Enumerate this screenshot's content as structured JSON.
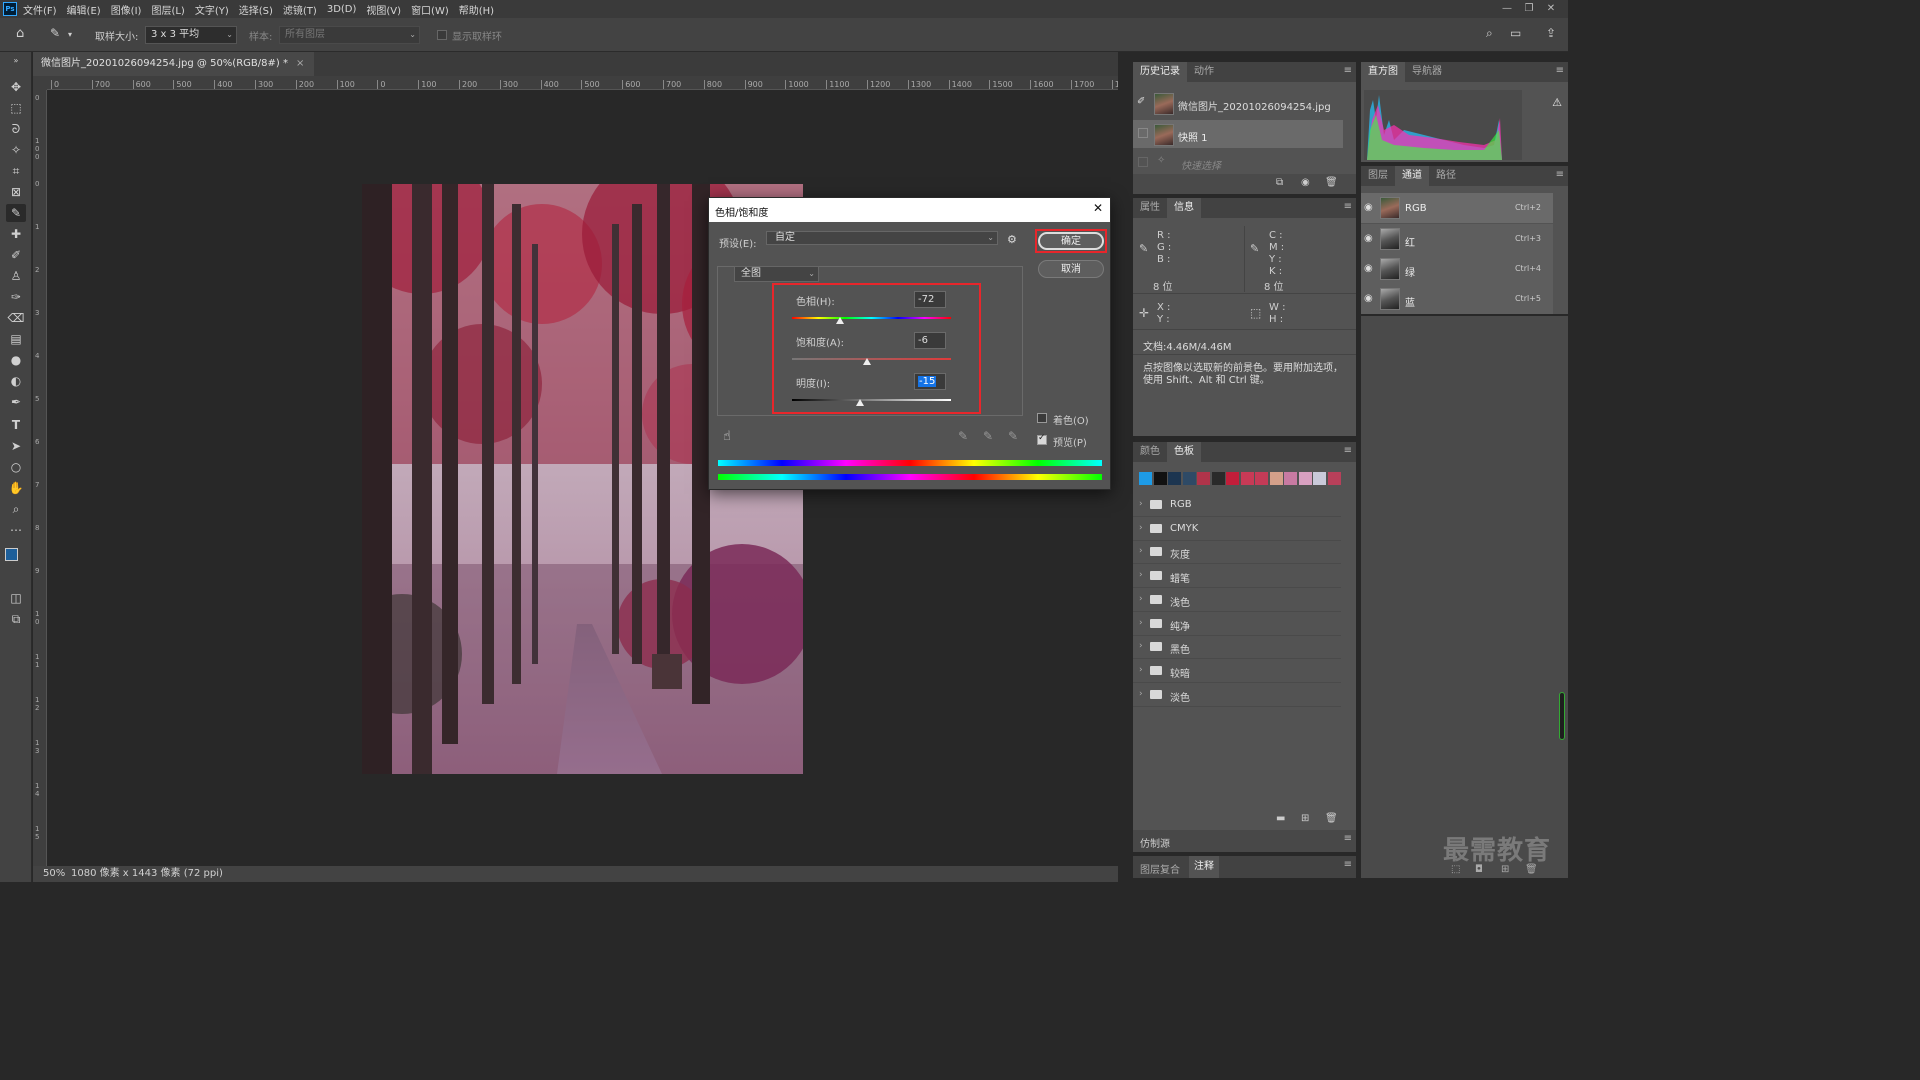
{
  "app": {
    "logo": "Ps"
  },
  "menu": [
    "文件(F)",
    "编辑(E)",
    "图像(I)",
    "图层(L)",
    "文字(Y)",
    "选择(S)",
    "滤镜(T)",
    "3D(D)",
    "视图(V)",
    "窗口(W)",
    "帮助(H)"
  ],
  "window_controls": {
    "minimize": "—",
    "restore": "❐",
    "close": "✕"
  },
  "options_bar": {
    "sample_size_label": "取样大小:",
    "sample_size_value": "3 x 3 平均",
    "sample_label": "样本:",
    "sample_value": "所有图层",
    "show_ring_label": "显示取样环"
  },
  "document": {
    "tab_title": "微信图片_20201026094254.jpg @ 50%(RGB/8#) *",
    "zoom": "50%",
    "status": "1080 像素 x 1443 像素 (72 ppi)"
  },
  "ruler_h": [
    "0",
    "700",
    "600",
    "500",
    "400",
    "300",
    "200",
    "100",
    "0",
    "100",
    "200",
    "300",
    "400",
    "500",
    "600",
    "700",
    "800",
    "900",
    "1000",
    "1100",
    "1200",
    "1300",
    "1400",
    "1500",
    "1600",
    "1700",
    "180"
  ],
  "ruler_v": [
    "0",
    "100",
    "0",
    "1",
    "2",
    "3",
    "4",
    "5",
    "6",
    "7",
    "8",
    "9",
    "10",
    "11",
    "12",
    "13",
    "14",
    "15"
  ],
  "history_panel": {
    "tabs": [
      "历史记录",
      "动作"
    ],
    "items": [
      "微信图片_20201026094254.jpg",
      "快照 1",
      "快速选择"
    ]
  },
  "histogram_panel": {
    "tabs": [
      "直方图",
      "导航器"
    ],
    "warning_icon": "⚠"
  },
  "info_panel": {
    "tabs": [
      "属性",
      "信息"
    ],
    "rgb": [
      "R :",
      "G :",
      "B :"
    ],
    "cmyk": [
      "C :",
      "M :",
      "Y :",
      "K :"
    ],
    "bits_left": "8 位",
    "bits_right": "8 位",
    "xy": [
      "X :",
      "Y :"
    ],
    "wh": [
      "W :",
      "H :"
    ],
    "doc_size": "文档:4.46M/4.46M",
    "hint": "点按图像以选取新的前景色。要用附加选项，使用 Shift、Alt 和 Ctrl 键。"
  },
  "channels_panel": {
    "tabs": [
      "图层",
      "通道",
      "路径"
    ],
    "channels": [
      {
        "name": "RGB",
        "shortcut": "Ctrl+2"
      },
      {
        "name": "红",
        "shortcut": "Ctrl+3"
      },
      {
        "name": "绿",
        "shortcut": "Ctrl+4"
      },
      {
        "name": "蓝",
        "shortcut": "Ctrl+5"
      }
    ]
  },
  "swatches_panel": {
    "tabs": [
      "颜色",
      "色板"
    ],
    "colors": [
      "#1e9be6",
      "#111111",
      "#1c3550",
      "#2e4a66",
      "#b0344a",
      "#2a2a2a",
      "#c21e3a",
      "#c83a56",
      "#c43b57",
      "#d4a08a",
      "#c87aa2",
      "#d8a0c0",
      "#c9c9d9",
      "#b8405a"
    ],
    "groups": [
      "RGB",
      "CMYK",
      "灰度",
      "蜡笔",
      "浅色",
      "纯净",
      "黑色",
      "较暗",
      "淡色"
    ]
  },
  "clone_source_panel": {
    "title": "仿制源"
  },
  "bottom_tabs": [
    "图层复合",
    "注释"
  ],
  "dialog": {
    "title": "色相/饱和度",
    "close": "✕",
    "preset_label": "预设(E):",
    "preset_value": "自定",
    "channel_value": "全图",
    "hue_label": "色相(H):",
    "hue_value": "-72",
    "saturation_label": "饱和度(A):",
    "saturation_value": "-6",
    "lightness_label": "明度(I):",
    "lightness_value": "-15",
    "ok_label": "确定",
    "cancel_label": "取消",
    "colorize_label": "着色(O)",
    "preview_label": "预览(P)",
    "slider_levels": {
      "hue": -72,
      "saturation": -6,
      "lightness": -15
    }
  },
  "watermark": "最需教育"
}
